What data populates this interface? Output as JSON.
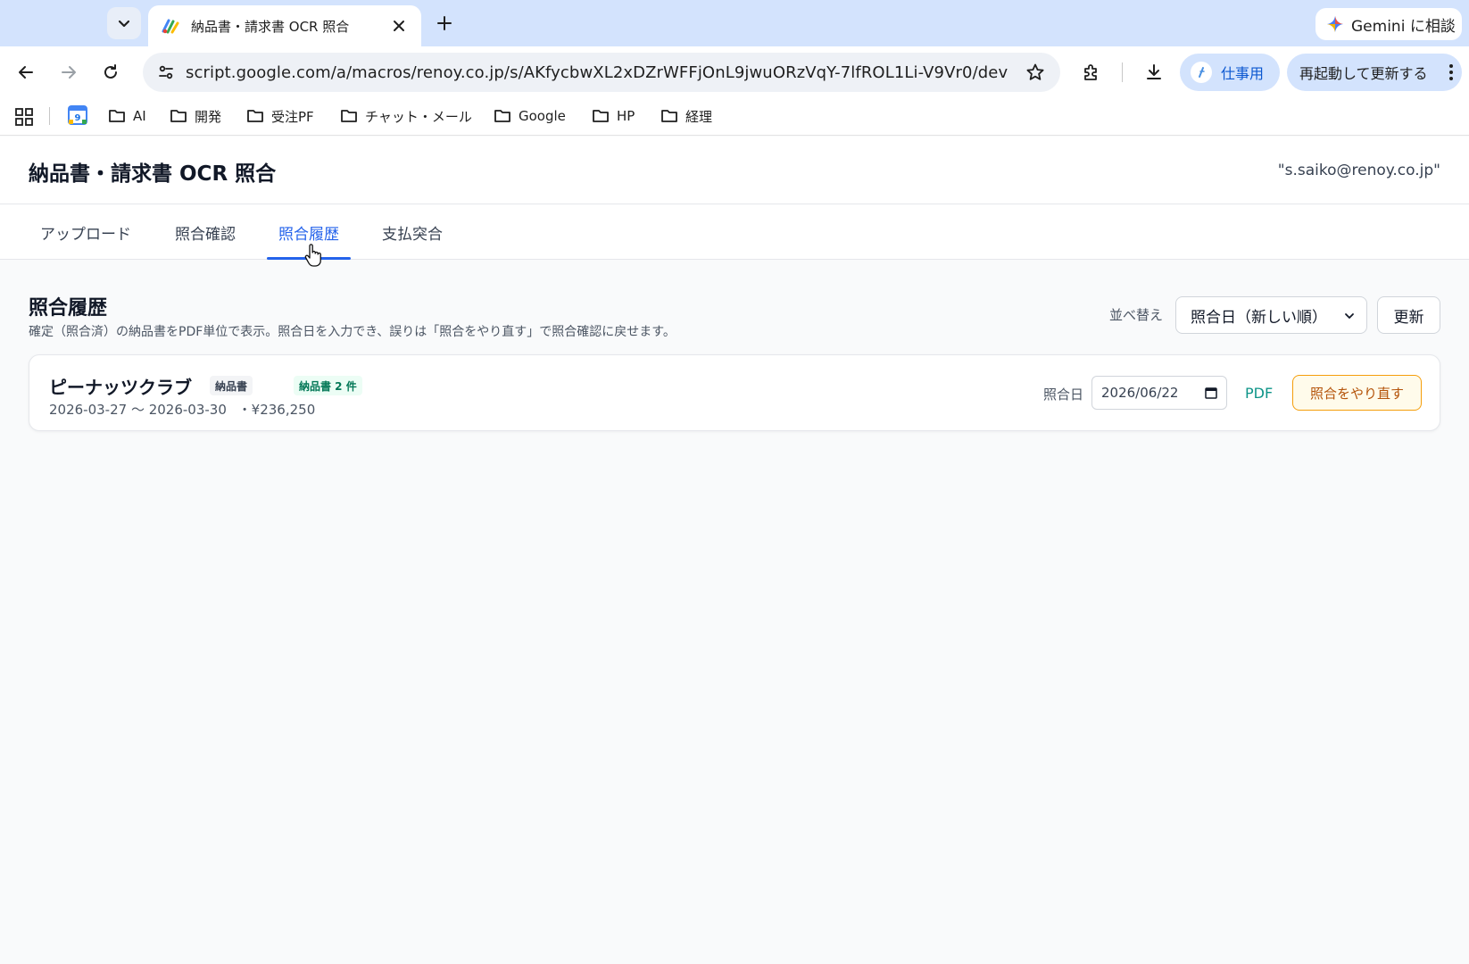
{
  "browser": {
    "tab_title": "納品書・請求書 OCR 照合",
    "gemini_label": "Gemini に相談",
    "url": "script.google.com/a/macros/renoy.co.jp/s/AKfycbwXL2xDZrWFFjOnL9jwuORzVqY-7lfROL1Li-V9Vr0/dev",
    "profile_label": "仕事用",
    "restart_label": "再起動して更新する",
    "bookmarks": [
      {
        "label": "AI"
      },
      {
        "label": "開発"
      },
      {
        "label": "受注PF"
      },
      {
        "label": "チャット・メール"
      },
      {
        "label": "Google"
      },
      {
        "label": "HP"
      },
      {
        "label": "経理"
      }
    ]
  },
  "app": {
    "title": "納品書・請求書 OCR 照合",
    "user_email": "\"s.saiko@renoy.co.jp\"",
    "tabs": [
      {
        "label": "アップロード"
      },
      {
        "label": "照合確認"
      },
      {
        "label": "照合履歴"
      },
      {
        "label": "支払突合"
      }
    ],
    "active_tab": "照合履歴"
  },
  "history": {
    "title": "照合履歴",
    "description": "確定（照合済）の納品書をPDF単位で表示。照合日を入力でき、誤りは「照合をやり直す」で照合確認に戻せます。",
    "sort_label": "並べ替え",
    "sort_value": "照合日（新しい順）",
    "refresh_label": "更新",
    "records": [
      {
        "vendor": "ピーナッツクラブ",
        "doc_type": "納品書",
        "count_label": "納品書 2 件",
        "period": "2026-03-27 〜 2026-03-30",
        "amount": "・¥236,250",
        "date_label": "照合日",
        "date_value": "2026/06/22",
        "pdf_label": "PDF",
        "redo_label": "照合をやり直す"
      }
    ]
  },
  "colors": {
    "accent": "#2563eb",
    "pdf_link": "#0d9488",
    "redo": "#b45309",
    "count_badge": "#047857"
  }
}
